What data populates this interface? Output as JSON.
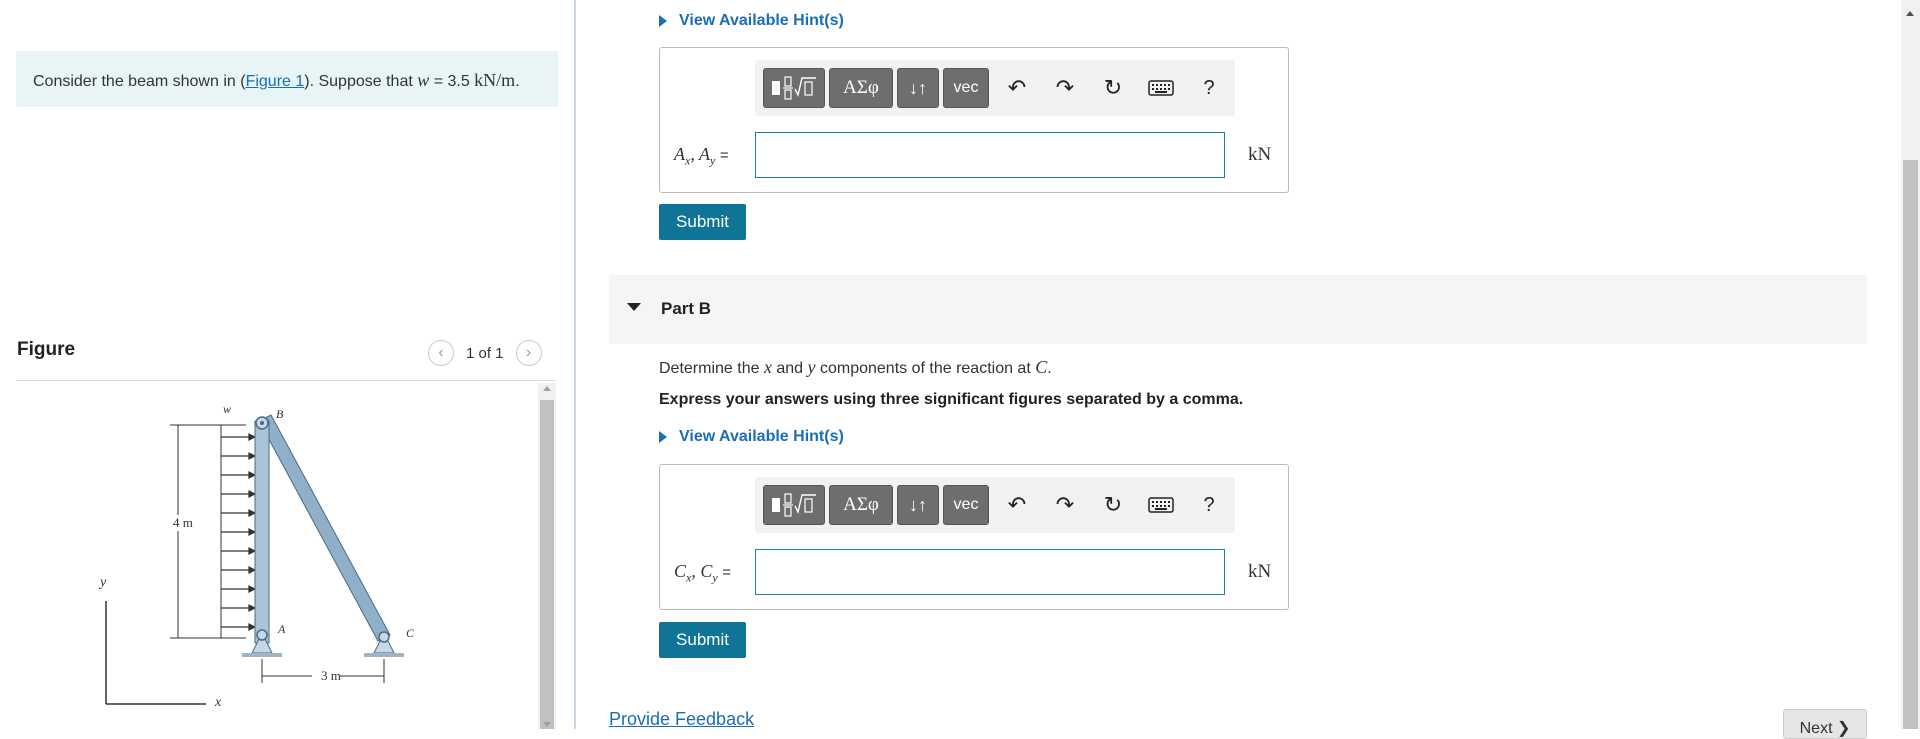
{
  "problem": {
    "text_before": "Consider the beam shown in (",
    "figure_link": "Figure 1",
    "text_mid": "). Suppose that ",
    "w_var": "w",
    "w_eq": " = 3.5 ",
    "w_unit": "kN/m",
    "text_end": "."
  },
  "figure_panel": {
    "title": "Figure",
    "pager": "1 of 1",
    "prev_icon": "chevron-left-icon",
    "next_icon": "chevron-right-icon",
    "labels": {
      "w": "w",
      "B": "B",
      "A": "A",
      "C": "C",
      "height": "4 m",
      "width": "3 m",
      "y": "y",
      "x": "x"
    }
  },
  "part_a": {
    "hint_label": "View Available Hint(s)",
    "answer_label": "Ax, Ay =",
    "unit": "kN",
    "submit_label": "Submit"
  },
  "part_b": {
    "title": "Part B",
    "question_before": "Determine the ",
    "q_x": "x",
    "question_mid": " and ",
    "q_y": "y",
    "question_after": " components of the reaction at ",
    "q_C": "C",
    "question_end": ".",
    "instruction": "Express your answers using three significant figures separated by a comma.",
    "hint_label": "View Available Hint(s)",
    "answer_label": "Cx, Cy =",
    "unit": "kN",
    "submit_label": "Submit"
  },
  "toolbar": {
    "templates_icon": "fraction-radical-template-icon",
    "greek_label": "ΑΣφ",
    "arrows_label": "↓↑",
    "vec_label": "vec",
    "undo_icon": "undo-icon",
    "redo_icon": "redo-icon",
    "reset_icon": "reset-icon",
    "keyboard_icon": "keyboard-icon",
    "help_label": "?"
  },
  "footer": {
    "feedback_label": "Provide Feedback",
    "next_label": "Next ❯"
  },
  "colors": {
    "accent": "#0f7496",
    "link": "#1a6eb5",
    "prompt_bg": "#e9f4f6",
    "beam": "#8fb0c8"
  }
}
